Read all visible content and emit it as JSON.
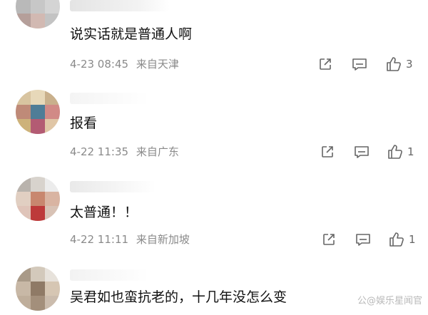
{
  "comments": [
    {
      "text": "说实话就是普通人啊",
      "date": "4-23 08:45",
      "location": "来自天津",
      "likes": "3",
      "avatar_colors": [
        "#d9d9d9",
        "#e6e6e6",
        "#cfcfcf",
        "#b9b9b9",
        "#c7c7c7",
        "#d4d4d4",
        "#b59f9a",
        "#d2b9b2",
        "#c3c3c3"
      ]
    },
    {
      "text": "报看",
      "date": "4-22 11:35",
      "location": "来自广东",
      "likes": "1",
      "avatar_colors": [
        "#d8c4a0",
        "#e7d8b9",
        "#c9b08c",
        "#bf8a78",
        "#4f7d97",
        "#d18a86",
        "#cdb27a",
        "#b35b73",
        "#e0c6a6"
      ]
    },
    {
      "text": "太普通！！",
      "date": "4-22 11:11",
      "location": "来自新加坡",
      "likes": "1",
      "avatar_colors": [
        "#b9b3ad",
        "#d8d3cd",
        "#ececec",
        "#e1cfc2",
        "#c8876f",
        "#d9b4a2",
        "#dfc4b9",
        "#bd3a3a",
        "#d8c2b5"
      ]
    },
    {
      "text": "吴君如也蛮抗老的，十几年没怎么变",
      "avatar_colors": [
        "#a99a88",
        "#d3c9bb",
        "#e7e2db",
        "#c8b8a6",
        "#8f7a66",
        "#d6c6b3",
        "#bfae9b",
        "#a38f7b",
        "#cbbcad"
      ]
    }
  ],
  "icons": {
    "share": "share-icon",
    "comment": "comment-icon",
    "like": "thumbs-up-icon"
  },
  "watermark": "公@娱乐星闻官"
}
